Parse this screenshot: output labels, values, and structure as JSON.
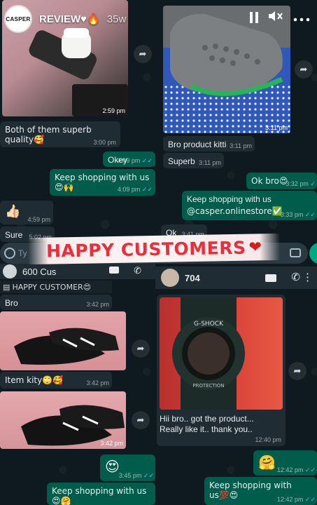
{
  "story": {
    "avatar_text": "CASPER",
    "username": "REVIEW♥🔥",
    "time": "35w",
    "icons": {
      "pause": "pause-icon",
      "mute": "mute-icon",
      "more": "more-icon"
    }
  },
  "banner": {
    "text": "HAPPY CUSTOMERS",
    "heart": "❤"
  },
  "left_top": {
    "img_time": "2:59 pm",
    "msg1": "Both of them superb quality🥰",
    "msg1_time": "3:00 pm",
    "out1": "Okey",
    "out1_time": "4:09 pm",
    "out2": "Keep shopping with us😍🙌",
    "out2_time": "4:09 pm",
    "thumb": "👍🏻",
    "thumb_time": "4:59 pm",
    "sure": "Sure",
    "sure_time": "5:02 pm",
    "type_placeholder": "Ty"
  },
  "right_top": {
    "img_time": "3:11 pm",
    "msg1": "Bro product kitti",
    "msg1_time": "3:11 pm",
    "msg2": "Superb",
    "msg2_time": "3:11 pm",
    "out1": "Ok bro😍",
    "out1_time": "3:32 pm",
    "out2_line1": "Keep shopping with us",
    "out2_line2": "@casper.onlinestore✅",
    "out2_time": "3:33 pm",
    "ok": "Ok",
    "ok_time": "3:41 pm"
  },
  "left_bottom": {
    "contact": "600 Cus",
    "pinned": "HAPPY CUSTOMER😍",
    "msg1": "Bro",
    "msg1_time": "3:42 pm",
    "img1_time": "3:42 pm",
    "msg2": "Item kity🙄🥰",
    "msg2_time": "3:42 pm",
    "img2_time": "3:42 pm",
    "emoji": "😍",
    "emoji_time": "3:45 pm",
    "out1": "Keep shopping with us😍🤗",
    "out1_time": "3:45 pm"
  },
  "right_bottom": {
    "contact": "704",
    "img_caption": "Hii bro.. got the product... Really like it.. thank you..",
    "img_time": "12:40 pm",
    "emoji": "🤗",
    "emoji_time": "12:42 pm",
    "out1": "Keep shopping with us💯😍",
    "out1_time": "12:42 pm"
  },
  "colors": {
    "incoming": "#1f2c33",
    "outgoing": "#005c4b",
    "banner_text": "#ea2f3a",
    "tick": "#53bdeb"
  }
}
